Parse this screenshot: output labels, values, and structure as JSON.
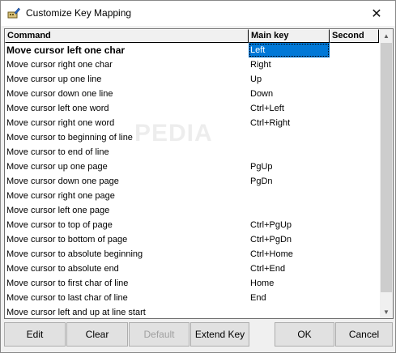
{
  "window": {
    "title": "Customize Key Mapping",
    "close_glyph": "✕"
  },
  "table": {
    "columns": [
      "Command",
      "Main key",
      "Second"
    ],
    "rows": [
      {
        "command": "Move cursor left one char",
        "main": "Left",
        "second": ""
      },
      {
        "command": "Move cursor right one char",
        "main": "Right",
        "second": ""
      },
      {
        "command": "Move cursor up one line",
        "main": "Up",
        "second": ""
      },
      {
        "command": "Move cursor down one line",
        "main": "Down",
        "second": ""
      },
      {
        "command": "Move cursor left one word",
        "main": "Ctrl+Left",
        "second": ""
      },
      {
        "command": "Move cursor right one word",
        "main": "Ctrl+Right",
        "second": ""
      },
      {
        "command": "Move cursor to beginning of line",
        "main": "",
        "second": ""
      },
      {
        "command": "Move cursor to end of line",
        "main": "",
        "second": ""
      },
      {
        "command": "Move cursor up one page",
        "main": "PgUp",
        "second": ""
      },
      {
        "command": "Move cursor down one page",
        "main": "PgDn",
        "second": ""
      },
      {
        "command": "Move cursor right one page",
        "main": "",
        "second": ""
      },
      {
        "command": "Move cursor left one page",
        "main": "",
        "second": ""
      },
      {
        "command": "Move cursor to top of page",
        "main": "Ctrl+PgUp",
        "second": ""
      },
      {
        "command": "Move cursor to bottom of page",
        "main": "Ctrl+PgDn",
        "second": ""
      },
      {
        "command": "Move cursor to absolute beginning",
        "main": "Ctrl+Home",
        "second": ""
      },
      {
        "command": "Move cursor to absolute end",
        "main": "Ctrl+End",
        "second": ""
      },
      {
        "command": "Move cursor to first char of line",
        "main": "Home",
        "second": ""
      },
      {
        "command": "Move cursor to last char of line",
        "main": "End",
        "second": ""
      },
      {
        "command": "Move cursor left and up at line start",
        "main": "",
        "second": ""
      }
    ],
    "selected_row": 0
  },
  "scrollbar": {
    "up_glyph": "▲",
    "down_glyph": "▼"
  },
  "buttons": {
    "edit": "Edit",
    "clear": "Clear",
    "default": "Default",
    "extend_key": "Extend Key",
    "ok": "OK",
    "cancel": "Cancel"
  },
  "watermark": "PEDIA"
}
